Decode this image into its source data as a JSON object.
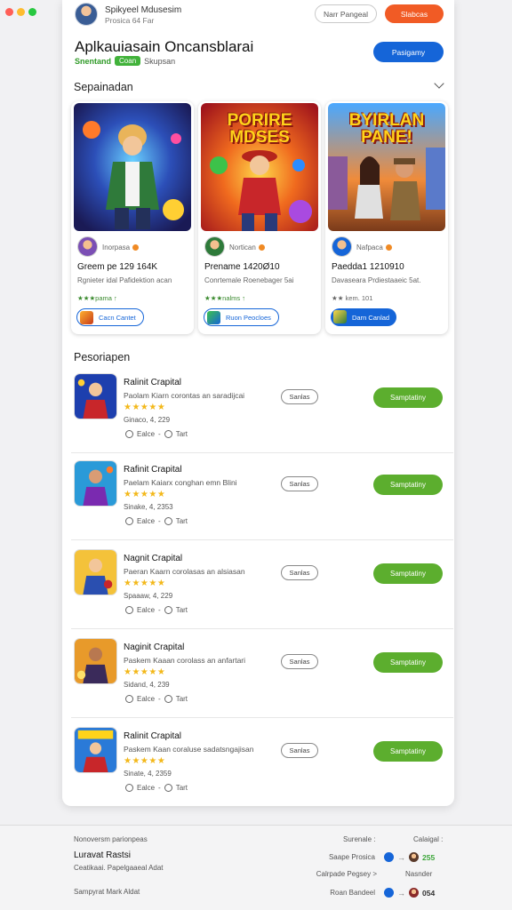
{
  "window": {
    "dot_colors": [
      "#ff5f57",
      "#febc2e",
      "#28c840"
    ]
  },
  "account": {
    "name": "Spikyeel Mdusesim",
    "sub": "Prosica 64 Far"
  },
  "top_buttons": {
    "outline": "Narr Pangeal",
    "primary": "Slabcas"
  },
  "app": {
    "title": "Aplkauiasain Oncansblarai",
    "brand": "Snentand",
    "badge": "Coan",
    "support": "Skupsan",
    "header_button": "Pasigamy"
  },
  "featured": {
    "title": "Sepainadan",
    "cards": [
      {
        "poster": "",
        "developer": "Inorpasa",
        "title": "Greem pe 129 164K",
        "desc": "Rgnieter idal Pafidektion acan",
        "rating": "★★★pama ↑",
        "cta": "Cacn Cantet",
        "cta_style": "outline"
      },
      {
        "poster": "PORIRE MDSES",
        "developer": "Nortican",
        "title": "Prename 1420Ø10",
        "desc": "Conrtemale Roenebager 5ai",
        "rating": "★★★nalms ↑",
        "cta": "Ruon Peocloes",
        "cta_style": "outline"
      },
      {
        "poster": "BYIRLAN PANE!",
        "developer": "Nafpaca",
        "title": "Paedda1 1210910",
        "desc": "Davaseara Prdiestaaeic 5at.",
        "rating": "★★ kem. 101",
        "cta": "Darn Canlad",
        "cta_style": "solid"
      }
    ]
  },
  "popular": {
    "title": "Pesoriapen",
    "items": [
      {
        "title": "Ralinit Crapital",
        "desc": "Paolam Kiarn corontas an saradijcai",
        "stars": "★★★★★",
        "stats": "Ginaco, 4, 229",
        "like": "Ealce",
        "save": "Tart",
        "outline_btn": "Sanlas",
        "primary_btn": "Samptatiny"
      },
      {
        "title": "Rafinit Crapital",
        "desc": "Paelam Kaiarx conghan emn Blini",
        "stars": "★★★★★",
        "stats": "Sinake, 4, 2353",
        "like": "Ealce",
        "save": "Tart",
        "outline_btn": "Sanlas",
        "primary_btn": "Samptatiny"
      },
      {
        "title": "Nagnit Crapital",
        "desc": "Paeran Kaarn corolasas an alsiasan",
        "stars": "★★★★★",
        "stats": "Spaaaw, 4, 229",
        "like": "Ealce",
        "save": "Tart",
        "outline_btn": "Sanlas",
        "primary_btn": "Samptatiny"
      },
      {
        "title": "Naginit Crapital",
        "desc": "Paskem Kaaan corolass an anfartari",
        "stars": "★★★★★",
        "stats": "Sidand, 4, 239",
        "like": "Ealce",
        "save": "Tart",
        "outline_btn": "Sanlas",
        "primary_btn": "Samptatiny"
      },
      {
        "title": "Ralinit Crapital",
        "desc": "Paskem Kaan coraluse sadatsngajisan",
        "stars": "★★★★★",
        "stats": "Sinate, 4, 2359",
        "like": "Ealce",
        "save": "Tart",
        "outline_btn": "Sanlas",
        "primary_btn": "Samptatiny"
      }
    ]
  },
  "footer": {
    "left_caption": "Nonoversm parionpeas",
    "left_title": "Luravat Rastsi",
    "left_sub": "Ceatikaai. Papelgaaeal Adat",
    "left_bottom": "Sampyrat Mark Aldat",
    "col1_header": "Surenale :",
    "col2_header": "Calaigal :",
    "rows": [
      {
        "label": "Saape Prosica",
        "value": "255",
        "value_color": "#3ca63a",
        "dot_color": "#1565d8"
      },
      {
        "label": "Calrpade Pegsey >",
        "value": "Nasnder",
        "value_color": "#666666",
        "dot_color": ""
      },
      {
        "label": "Roan Bandeel",
        "value": "054",
        "value_color": "#333333",
        "dot_color": "#1565d8"
      }
    ]
  }
}
